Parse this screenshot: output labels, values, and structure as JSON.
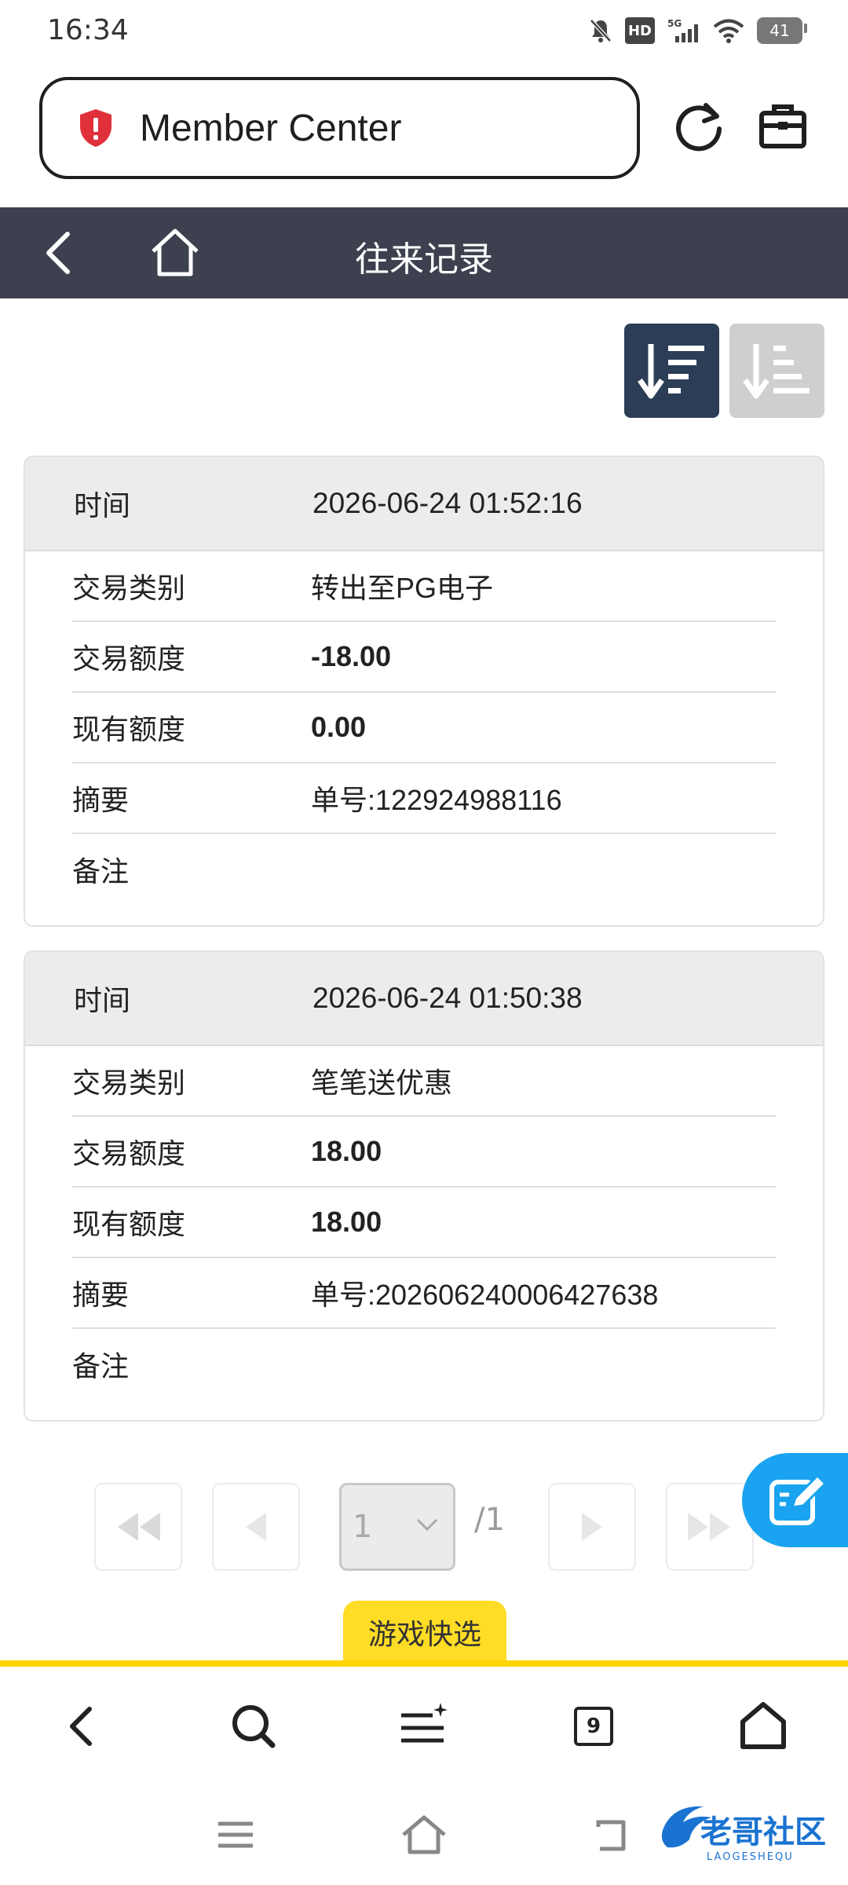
{
  "status_bar": {
    "time": "16:34",
    "hd_label": "HD",
    "network_label": "5G",
    "battery_level": "41",
    "icons": [
      "bell-muted-icon",
      "hd-icon",
      "signal-icon",
      "wifi-icon",
      "battery-icon"
    ]
  },
  "browser": {
    "url_text": "Member Center",
    "icons": [
      "shield-icon",
      "refresh-icon",
      "briefcase-icon"
    ]
  },
  "header": {
    "title": "往来记录"
  },
  "records": [
    {
      "time_label": "时间",
      "time_value": "2026-06-24 01:52:16",
      "type_label": "交易类别",
      "type_value": "转出至PG电子",
      "amount_label": "交易额度",
      "amount_value": "-18.00",
      "balance_label": "现有额度",
      "balance_value": "0.00",
      "summary_label": "摘要",
      "summary_value": "单号:122924988116",
      "note_label": "备注",
      "note_value": ""
    },
    {
      "time_label": "时间",
      "time_value": "2026-06-24 01:50:38",
      "type_label": "交易类别",
      "type_value": "笔笔送优惠",
      "amount_label": "交易额度",
      "amount_value": "18.00",
      "balance_label": "现有额度",
      "balance_value": "18.00",
      "summary_label": "摘要",
      "summary_value": "单号:202606240006427638",
      "note_label": "备注",
      "note_value": ""
    }
  ],
  "pagination": {
    "current_page": "1",
    "total_pages": "/1"
  },
  "game_quick": {
    "label": "游戏快选"
  },
  "watermark": {
    "text": "老哥社区",
    "subtext": "LAOGESHEQU"
  },
  "colors": {
    "header_bg": "#3d414f",
    "sort_active": "#2c3e56",
    "sort_inactive": "#cfcfcf",
    "accent_yellow": "#ffd400",
    "fab_blue": "#1aa3f0",
    "danger_red": "#e0303a"
  }
}
